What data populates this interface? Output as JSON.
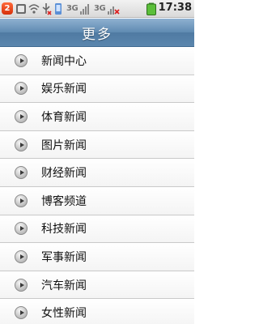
{
  "status_bar": {
    "notification_count": "2",
    "network_1": "3G",
    "network_2": "3G",
    "time": "17:38"
  },
  "header": {
    "title": "更多"
  },
  "menu": {
    "items": [
      {
        "label": "新闻中心"
      },
      {
        "label": "娱乐新闻"
      },
      {
        "label": "体育新闻"
      },
      {
        "label": "图片新闻"
      },
      {
        "label": "财经新闻"
      },
      {
        "label": "博客频道"
      },
      {
        "label": "科技新闻"
      },
      {
        "label": "军事新闻"
      },
      {
        "label": "汽车新闻"
      },
      {
        "label": "女性新闻"
      }
    ]
  },
  "icons": {
    "row_arrow": "chevron-right-circle-icon"
  }
}
